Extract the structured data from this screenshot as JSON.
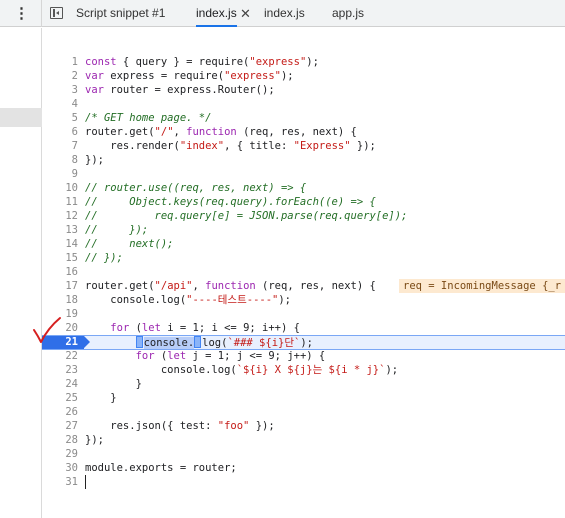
{
  "tabs": [
    {
      "label": "Script snippet #1",
      "active": false
    },
    {
      "label": "index.js",
      "active": true,
      "closable": true
    },
    {
      "label": "index.js",
      "active": false
    },
    {
      "label": "app.js",
      "active": false
    }
  ],
  "close_glyph": "✕",
  "editor": {
    "breakpoint_line": 21,
    "inline_value": "req = IncomingMessage {_r",
    "lines": [
      {
        "n": "1",
        "t": "const { query } = require(\"express\");"
      },
      {
        "n": "2",
        "t": "var express = require(\"express\");"
      },
      {
        "n": "3",
        "t": "var router = express.Router();"
      },
      {
        "n": "4",
        "t": ""
      },
      {
        "n": "5",
        "t": "/* GET home page. */"
      },
      {
        "n": "6",
        "t": "router.get(\"/\", function (req, res, next) {"
      },
      {
        "n": "7",
        "t": "    res.render(\"index\", { title: \"Express\" });"
      },
      {
        "n": "8",
        "t": "});"
      },
      {
        "n": "9",
        "t": ""
      },
      {
        "n": "10",
        "t": "// router.use((req, res, next) => {"
      },
      {
        "n": "11",
        "t": "//     Object.keys(req.query).forEach((e) => {"
      },
      {
        "n": "12",
        "t": "//         req.query[e] = JSON.parse(req.query[e]);"
      },
      {
        "n": "13",
        "t": "//     });"
      },
      {
        "n": "14",
        "t": "//     next();"
      },
      {
        "n": "15",
        "t": "// });"
      },
      {
        "n": "16",
        "t": ""
      },
      {
        "n": "17",
        "t": "router.get(\"/api\", function (req, res, next) {"
      },
      {
        "n": "18",
        "t": "    console.log(\"----테스트----\");"
      },
      {
        "n": "19",
        "t": ""
      },
      {
        "n": "20",
        "t": "    for (let i = 1; i <= 9; i++) {"
      },
      {
        "n": "21",
        "t": "        console.log(`### ${i}단`);"
      },
      {
        "n": "22",
        "t": "        for (let j = 1; j <= 9; j++) {"
      },
      {
        "n": "23",
        "t": "            console.log(`${i} X ${j}는 ${i * j}`);"
      },
      {
        "n": "24",
        "t": "        }"
      },
      {
        "n": "25",
        "t": "    }"
      },
      {
        "n": "26",
        "t": ""
      },
      {
        "n": "27",
        "t": "    res.json({ test: \"foo\" });"
      },
      {
        "n": "28",
        "t": "});"
      },
      {
        "n": "29",
        "t": ""
      },
      {
        "n": "30",
        "t": "module.exports = router;"
      },
      {
        "n": "31",
        "t": ""
      }
    ]
  },
  "colors": {
    "keyword": "#9c27b0",
    "string": "#c41a16",
    "comment": "#236e25",
    "breakpoint": "#2f6fe8"
  }
}
